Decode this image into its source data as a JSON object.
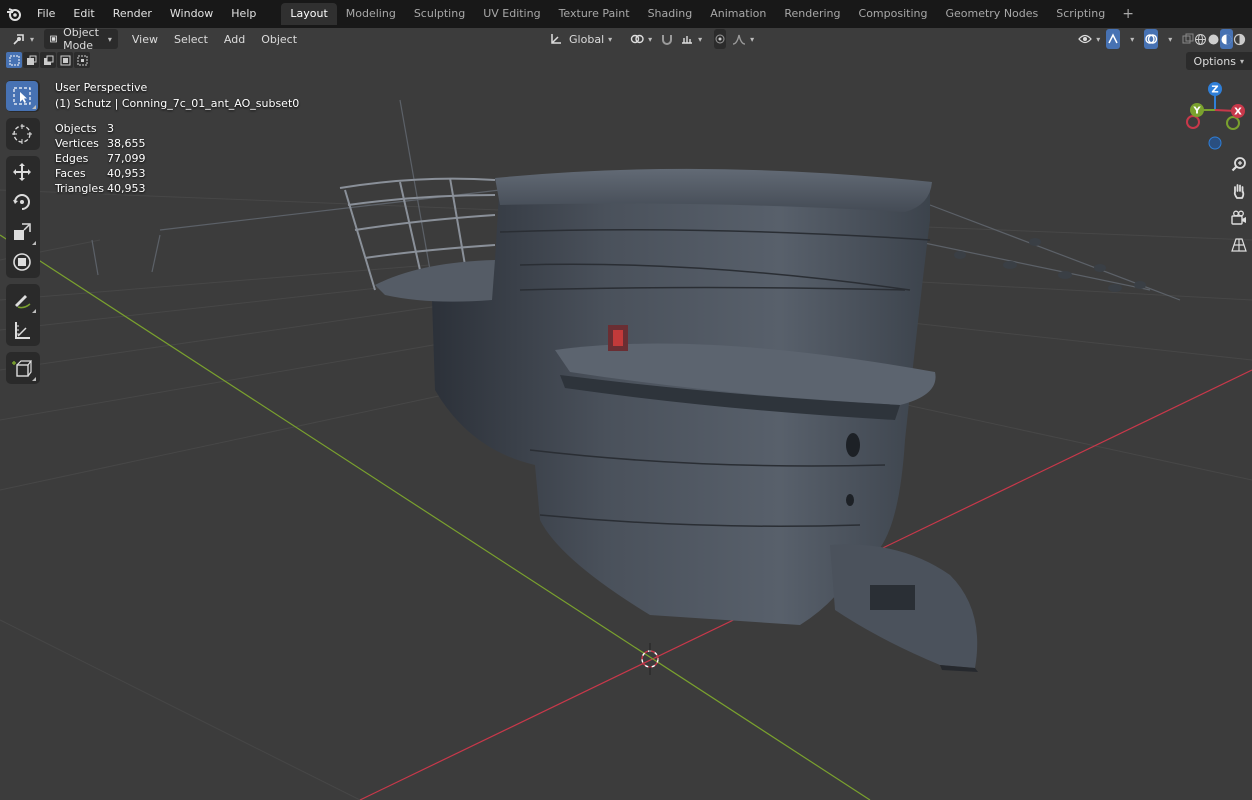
{
  "menubar": {
    "items": [
      "File",
      "Edit",
      "Render",
      "Window",
      "Help"
    ],
    "workspaces": [
      "Layout",
      "Modeling",
      "Sculpting",
      "UV Editing",
      "Texture Paint",
      "Shading",
      "Animation",
      "Rendering",
      "Compositing",
      "Geometry Nodes",
      "Scripting"
    ],
    "active_workspace": "Layout",
    "add_tab_symbol": "+"
  },
  "header": {
    "mode": "Object Mode",
    "menus": [
      "View",
      "Select",
      "Add",
      "Object"
    ],
    "transform_orientation": "Global",
    "options_label": "Options"
  },
  "viewport": {
    "view_name": "User Perspective",
    "object_line": "(1) Schutz | Conning_7c_01_ant_AO_subset0",
    "stats": [
      {
        "label": "Objects",
        "value": "3"
      },
      {
        "label": "Vertices",
        "value": "38,655"
      },
      {
        "label": "Edges",
        "value": "77,099"
      },
      {
        "label": "Faces",
        "value": "40,953"
      },
      {
        "label": "Triangles",
        "value": "40,953"
      }
    ]
  },
  "gizmo": {
    "x_label": "X",
    "y_label": "Y",
    "z_label": "Z"
  },
  "colors": {
    "accent": "#4772b3",
    "axis_x": "#c8384a",
    "axis_y": "#7aa12e",
    "axis_z": "#2f7fd8"
  },
  "icons": {
    "toolbar": [
      "select-box-icon",
      "cursor-icon",
      "move-icon",
      "rotate-icon",
      "scale-icon",
      "transform-icon",
      "annotate-icon",
      "measure-icon",
      "add-cube-icon"
    ],
    "nav": [
      "zoom-icon",
      "pan-hand-icon",
      "camera-view-icon",
      "perspective-grid-icon"
    ]
  }
}
